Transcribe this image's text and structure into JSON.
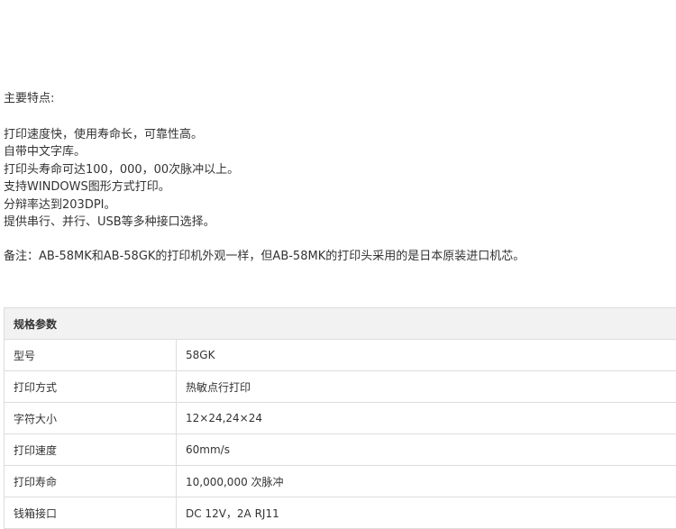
{
  "features": {
    "heading": "主要特点:",
    "lines": [
      "打印速度快，使用寿命长，可靠性高。",
      "自带中文字库。",
      "打印头寿命可达100，000，00次脉冲以上。",
      "支持WINDOWS图形方式打印。",
      "分辩率达到203DPI。",
      "提供串行、并行、USB等多种接口选择。"
    ],
    "note": "备注：AB-58MK和AB-58GK的打印机外观一样，但AB-58MK的打印头采用的是日本原装进口机芯。"
  },
  "spec_table": {
    "header": "规格参数",
    "rows": [
      {
        "label": "型号",
        "value": "58GK"
      },
      {
        "label": "打印方式",
        "value": "热敏点行打印"
      },
      {
        "label": "字符大小",
        "value": "12×24,24×24"
      },
      {
        "label": "打印速度",
        "value": "60mm/s"
      },
      {
        "label": "打印寿命",
        "value": "10,000,000 次脉冲"
      },
      {
        "label": "钱箱接口",
        "value": "DC 12V，2A RJ11"
      }
    ]
  }
}
